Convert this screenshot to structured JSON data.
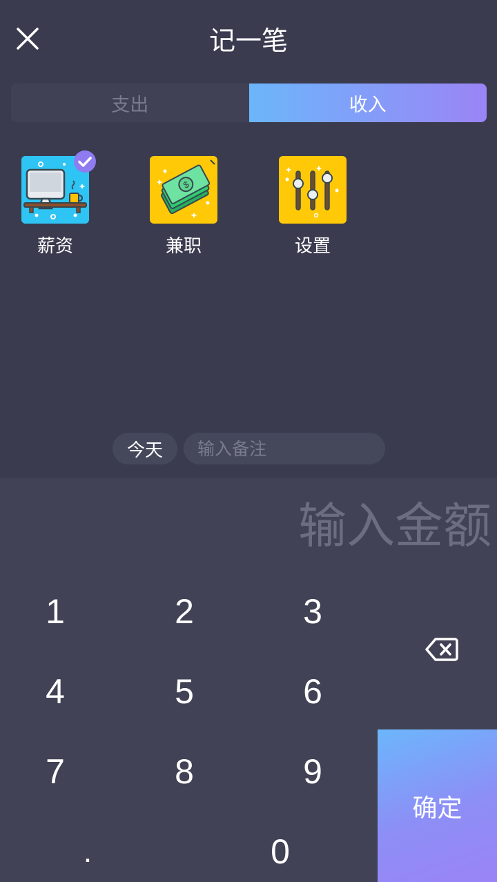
{
  "header": {
    "title": "记一笔",
    "close_icon": "close-icon"
  },
  "tabs": [
    {
      "label": "支出",
      "active": false
    },
    {
      "label": "收入",
      "active": true
    }
  ],
  "categories": [
    {
      "label": "薪资",
      "icon": "desk-computer-icon",
      "selected": true
    },
    {
      "label": "兼职",
      "icon": "money-bills-icon",
      "selected": false
    },
    {
      "label": "设置",
      "icon": "sliders-icon",
      "selected": false
    }
  ],
  "entry": {
    "date_label": "今天",
    "note_placeholder": "输入备注",
    "amount_placeholder": "输入金额"
  },
  "keypad": {
    "keys": [
      "1",
      "2",
      "3",
      "4",
      "5",
      "6",
      "7",
      "8",
      "9",
      ".",
      "0"
    ],
    "backspace_icon": "backspace-icon",
    "confirm_label": "确定"
  },
  "colors": {
    "background": "#3a3b4f",
    "keypad_background": "#424256",
    "gradient_start": "#6cb6fb",
    "gradient_end": "#9b84f6",
    "muted_text": "#7a7b8c"
  }
}
